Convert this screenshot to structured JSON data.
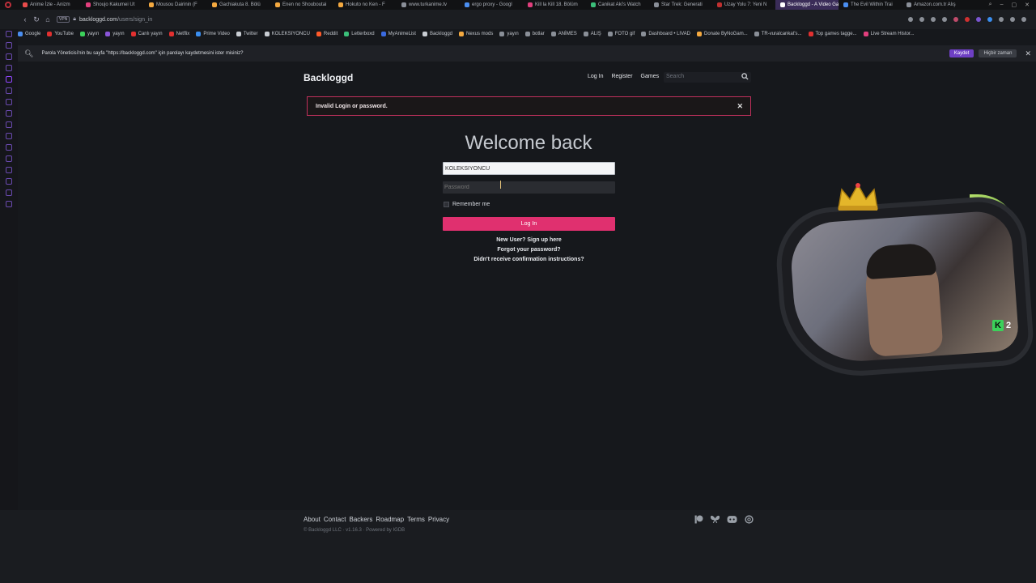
{
  "browser": {
    "tabs": [
      {
        "label": "Anime İzle - Anizm",
        "color": "#e94b4b"
      },
      {
        "label": "Shoujo Kakumei Ut",
        "color": "#e23f7d"
      },
      {
        "label": "Mousou Dairinin (F",
        "color": "#f4a940"
      },
      {
        "label": "Gachiakuta 8. Bölü",
        "color": "#f4a940"
      },
      {
        "label": "Enen no Shouboutai",
        "color": "#f4a940"
      },
      {
        "label": "Hokuto no Ken - F",
        "color": "#f4a940"
      },
      {
        "label": "www.turkanime.tv",
        "color": "#8a8f98"
      },
      {
        "label": "ergo proxy - Googl",
        "color": "#4a8ef0"
      },
      {
        "label": "Kill la Kill 18. Bölüm",
        "color": "#e23f7d"
      },
      {
        "label": "Canikat Aki's Watch",
        "color": "#3bbf7a"
      },
      {
        "label": "Star Trek: Generati",
        "color": "#8a8f98"
      },
      {
        "label": "Uzay Yolu 7: Yeni N",
        "color": "#c03030"
      },
      {
        "label": "Backloggd - A Video Gam",
        "color": "#ffffff",
        "active": true
      },
      {
        "label": "The Evil Within Trai",
        "color": "#4a8ef0"
      },
      {
        "label": "Amazon.com.tr Alış",
        "color": "#8a8f98"
      }
    ],
    "address": {
      "vpn": "VPN",
      "domain": "backloggd.com",
      "path": "/users/sign_in"
    },
    "bookmarks": [
      {
        "label": "Google",
        "color": "#4a8ef0"
      },
      {
        "label": "YouTube",
        "color": "#e23030"
      },
      {
        "label": "yayın",
        "color": "#3bd15a"
      },
      {
        "label": "yayın",
        "color": "#8a55d8"
      },
      {
        "label": "Canlı yayın",
        "color": "#e23030"
      },
      {
        "label": "Netflix",
        "color": "#e23030"
      },
      {
        "label": "Prime Video",
        "color": "#3a8ef0"
      },
      {
        "label": "Twitter",
        "color": "#c8ccd2"
      },
      {
        "label": "KOLEKSIYONCU",
        "color": "#c8ccd2"
      },
      {
        "label": "Reddit",
        "color": "#ff5a2a"
      },
      {
        "label": "Letterboxd",
        "color": "#3bbf7a"
      },
      {
        "label": "MyAnimeList",
        "color": "#3a6ae0"
      },
      {
        "label": "Backloggd",
        "color": "#c8ccd2"
      },
      {
        "label": "Nexus mods",
        "color": "#f4a940"
      },
      {
        "label": "yayın",
        "color": "#8a8f98"
      },
      {
        "label": "botlar",
        "color": "#8a8f98"
      },
      {
        "label": "ANİMES",
        "color": "#8a8f98"
      },
      {
        "label": "ALIŞ",
        "color": "#8a8f98"
      },
      {
        "label": "FOTO gif",
        "color": "#8a8f98"
      },
      {
        "label": "Dashboard • LIVAD",
        "color": "#8a8f98"
      },
      {
        "label": "Donate ByNoGam...",
        "color": "#f4a940"
      },
      {
        "label": "TR-vuralcankat's...",
        "color": "#8a8f98"
      },
      {
        "label": "Top games tagge...",
        "color": "#e23030"
      },
      {
        "label": "Live Stream Histor...",
        "color": "#e23f7d"
      }
    ]
  },
  "password_prompt": {
    "message": "Parola Yöneticisi'nin bu sayfa \"https://backloggd.com\" için parolayı kaydetmesini ister misiniz?",
    "save_label": "Kaydet",
    "never_label": "Hiçbir zaman"
  },
  "site": {
    "logo": "Backloggd",
    "nav": [
      "Log In",
      "Register",
      "Games"
    ],
    "search_placeholder": "Search",
    "alert": "Invalid Login or password.",
    "heading": "Welcome back",
    "username_value": "KOLEKSIYONCU",
    "password_placeholder": "Password",
    "remember_label": "Remember me",
    "login_button": "Log In",
    "links": {
      "signup": "New User? Sign up here",
      "forgot": "Forgot your password?",
      "confirm": "Didn't receive confirmation instructions?"
    },
    "footer": {
      "links": [
        "About",
        "Contact",
        "Backers",
        "Roadmap",
        "Terms",
        "Privacy"
      ],
      "copyright": "© Backloggd LLC · v1.16.3 · Powered by IGDB",
      "social": [
        "patreon-icon",
        "bluesky-icon",
        "discord-icon",
        "threads-icon"
      ]
    }
  },
  "overlay": {
    "badge_letter": "K",
    "badge_count": "2"
  },
  "colors": {
    "accent": "#e0306f",
    "alert_border": "#c0305c",
    "browser_accent": "#6e3fc4"
  }
}
